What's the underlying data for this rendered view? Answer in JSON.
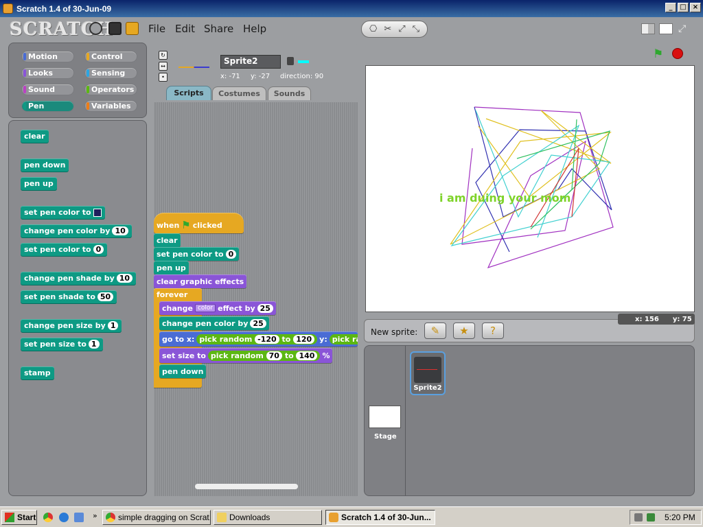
{
  "window": {
    "title": "Scratch 1.4 of 30-Jun-09",
    "min": "_",
    "max": "□",
    "close": "×"
  },
  "menu": {
    "logo": "SCRATCH",
    "items": [
      "File",
      "Edit",
      "Share",
      "Help"
    ]
  },
  "categories": [
    "Motion",
    "Control",
    "Looks",
    "Sensing",
    "Sound",
    "Operators",
    "Pen",
    "Variables"
  ],
  "category_selected": "Pen",
  "category_colors": [
    "#4a6cd4",
    "#e6a822",
    "#8a55d7",
    "#2ca5e2",
    "#bb42c3",
    "#5cb712",
    "#0e9a84",
    "#ee7d16"
  ],
  "palette": {
    "clear": "clear",
    "pen_down": "pen down",
    "pen_up": "pen up",
    "set_pen_color_to": "set pen color to",
    "change_pen_color_by": "change pen color by",
    "change_pen_color_val": "10",
    "set_pen_color_to_num": "set pen color to",
    "set_pen_color_val": "0",
    "change_pen_shade_by": "change pen shade by",
    "change_pen_shade_val": "10",
    "set_pen_shade_to": "set pen shade to",
    "set_pen_shade_val": "50",
    "change_pen_size_by": "change pen size by",
    "change_pen_size_val": "1",
    "set_pen_size_to": "set pen size to",
    "set_pen_size_val": "1",
    "stamp": "stamp"
  },
  "sprite": {
    "name": "Sprite2",
    "x": "x: -71",
    "y": "y: -27",
    "direction": "direction: 90"
  },
  "tabs": [
    "Scripts",
    "Costumes",
    "Sounds"
  ],
  "script": {
    "when": "when",
    "clicked": "clicked",
    "clear": "clear",
    "set_pen_color": "set pen color to",
    "set_pen_color_val": "0",
    "pen_up": "pen up",
    "clear_graphic": "clear graphic effects",
    "forever": "forever",
    "change": "change",
    "effect_dd": "color",
    "effect_by": "effect by",
    "effect_val": "25",
    "change_pen_color": "change pen color by",
    "change_pen_color_val": "25",
    "goto": "go to x:",
    "pick_random": "pick random",
    "rand1_a": "-120",
    "to": "to",
    "rand1_b": "120",
    "y": "y:",
    "pick_ra": "pick ra",
    "set_size": "set size to",
    "rand2_a": "70",
    "rand2_b": "140",
    "pct": "%",
    "pen_down": "pen down"
  },
  "stage": {
    "text": "i am duing your mom",
    "text_color": "#7fd32a",
    "mouse_x": "x: 156",
    "mouse_y": "y: 75"
  },
  "new_sprite": {
    "label": "New sprite:"
  },
  "sprites": {
    "sprite_label": "Sprite2",
    "stage_label": "Stage"
  },
  "taskbar": {
    "start": "Start",
    "tasks": [
      "simple dragging on Scrat...",
      "Downloads",
      "Scratch 1.4 of 30-Jun..."
    ],
    "clock": "5:20 PM"
  }
}
